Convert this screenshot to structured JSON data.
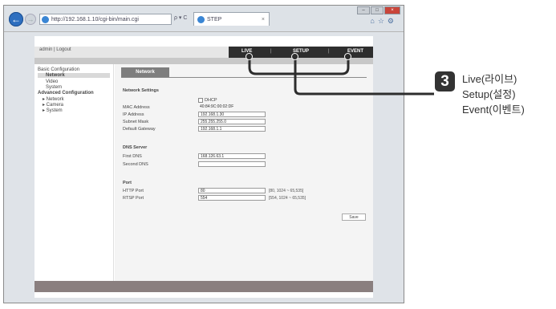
{
  "browser": {
    "address": "http://192.168.1.10/cgi-bin/main.cgi",
    "address_tools": "ρ ▾ C",
    "tab_title": "STEP",
    "tab_close": "×",
    "win_min": "–",
    "win_max": "□",
    "win_close": "×",
    "right_tools": "⌂☆⚙"
  },
  "header": {
    "user_links": "admin | Logout",
    "nav": {
      "live": "LIVE",
      "setup": "SETUP",
      "event": "EVENT",
      "separator": "|"
    }
  },
  "sidebar": {
    "items": [
      {
        "label": "Basic Configuration"
      },
      {
        "label": "Network"
      },
      {
        "label": "Video"
      },
      {
        "label": "System"
      },
      {
        "label": "Advanced Configuration"
      },
      {
        "label": "▸ Network"
      },
      {
        "label": "▸ Camera"
      },
      {
        "label": "▸ System"
      }
    ]
  },
  "content": {
    "tab": "Network",
    "network_settings": {
      "title": "Network Settings",
      "dhcp_label": "DHCP",
      "mac_label": "MAC Address",
      "mac_value": "40:84:9C:00:02:DF",
      "ip_label": "IP Address",
      "ip_value": "192.168.1.30",
      "subnet_label": "Subnet Mask",
      "subnet_value": "255.255.255.0",
      "gateway_label": "Default Gateway",
      "gateway_value": "192.168.1.1"
    },
    "dns": {
      "title": "DNS Server",
      "first_label": "First DNS",
      "first_value": "168.126.63.1",
      "second_label": "Second DNS",
      "second_value": ""
    },
    "port": {
      "title": "Port",
      "http_label": "HTTP Port",
      "http_value": "80",
      "http_hint": "[80, 1024 ~ 65,535]",
      "rtsp_label": "RTSP Port",
      "rtsp_value": "554",
      "rtsp_hint": "[554, 1024 ~ 65,535]"
    },
    "save": "Save"
  },
  "callout": {
    "number": "3",
    "lines": [
      "Live(라이브)",
      "Setup(설정)",
      "Event(이벤트)"
    ]
  }
}
